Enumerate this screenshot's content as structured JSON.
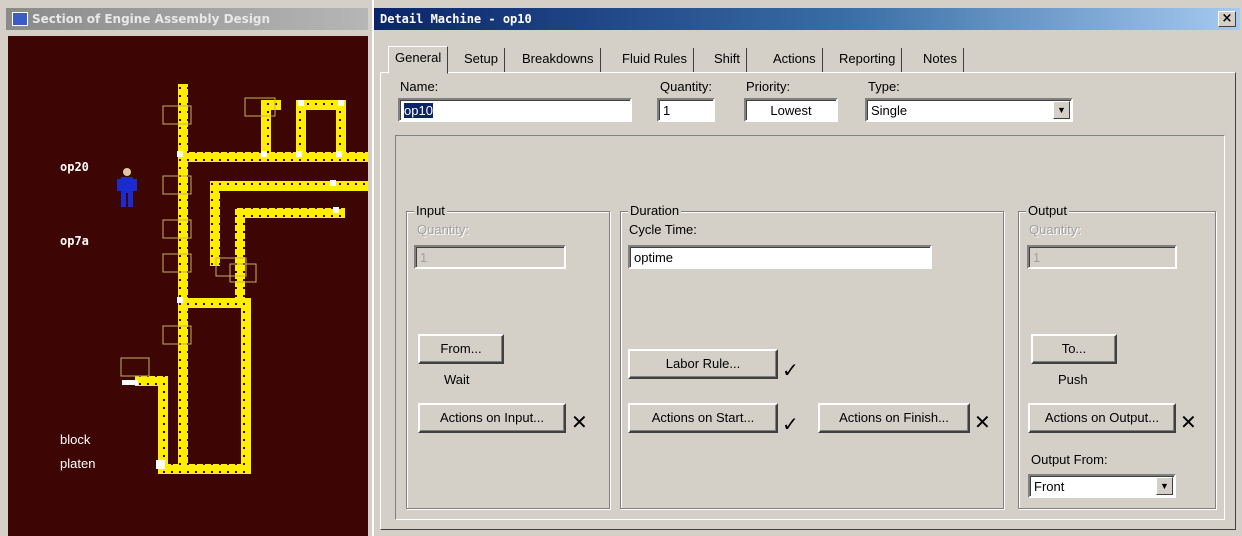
{
  "left_window": {
    "title": "Section of Engine Assembly Design",
    "labels": [
      "op20",
      "op7a",
      "block",
      "platen"
    ]
  },
  "dialog": {
    "title": "Detail Machine - op10",
    "close_glyph": "×",
    "tabs": [
      "General",
      "Setup",
      "Breakdowns",
      "Fluid Rules",
      "Shift",
      "Actions",
      "Reporting",
      "Notes"
    ],
    "active_tab": "General",
    "general": {
      "name": {
        "label": "Name:",
        "value": "op10"
      },
      "quantity": {
        "label": "Quantity:",
        "value": "1"
      },
      "priority": {
        "label": "Priority:",
        "value": "Lowest"
      },
      "type": {
        "label": "Type:",
        "value": "Single"
      },
      "input": {
        "group_title": "Input",
        "quantity_label": "Quantity:",
        "quantity_value": "1",
        "from_button": "From...",
        "rule_text": "Wait",
        "actions_button": "Actions on Input...",
        "actions_mark": "✕"
      },
      "duration": {
        "group_title": "Duration",
        "cycle_time_label": "Cycle Time:",
        "cycle_time_value": "optime",
        "labor_rule_button": "Labor Rule...",
        "labor_rule_mark": "✓",
        "actions_start_button": "Actions on Start...",
        "actions_start_mark": "✓",
        "actions_finish_button": "Actions on Finish...",
        "actions_finish_mark": "✕"
      },
      "output": {
        "group_title": "Output",
        "quantity_label": "Quantity:",
        "quantity_value": "1",
        "to_button": "To...",
        "rule_text": "Push",
        "actions_button": "Actions on Output...",
        "actions_mark": "✕",
        "output_from_label": "Output From:",
        "output_from_value": "Front"
      }
    }
  },
  "colors": {
    "canvas_bg": "#3d0604",
    "conveyor": "#ffee00",
    "window_face": "#d4d0c8",
    "titlebar_active": "#0a246a",
    "titlebar_inactive": "#8a8a8a",
    "operator": "#1a2bd0"
  },
  "icons": [
    "app-icon",
    "close-icon",
    "check-icon",
    "cross-icon",
    "dropdown-arrow-icon",
    "operator-icon"
  ]
}
